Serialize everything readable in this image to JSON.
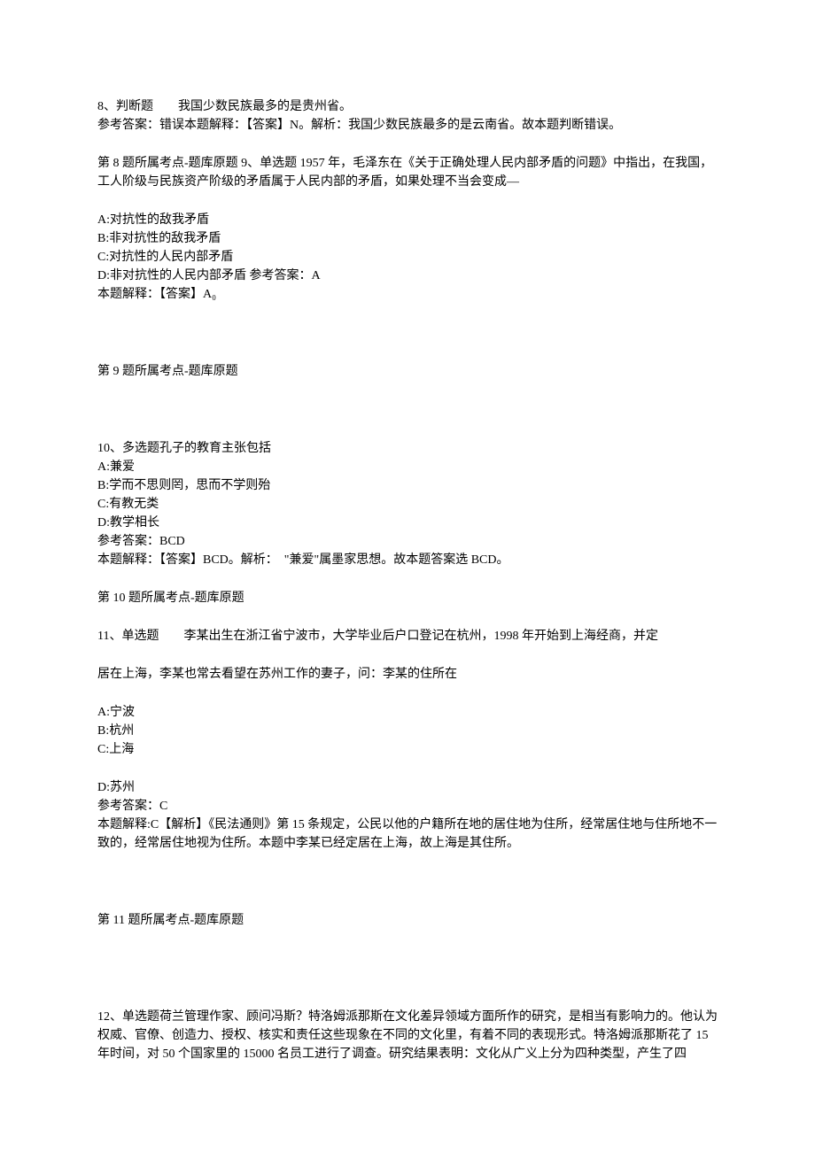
{
  "q8": {
    "line1": "8、判断题　　我国少数民族最多的是贵州省。",
    "line2": "参考答案：错误本题解释：【答案】N。解析：我国少数民族最多的是云南省。故本题判断错误。"
  },
  "q9intro": {
    "line1": "第 8 题所属考点-题库原题 9、单选题 1957 年，毛泽东在《关于正确处理人民内部矛盾的问题》中指出，在我国，工人阶级与民族资产阶级的矛盾属于人民内部的矛盾，如果处理不当会变成—"
  },
  "q9": {
    "optA": "A:对抗性的敌我矛盾",
    "optB": "B:非对抗性的敌我矛盾",
    "optC": "C:对抗性的人民内部矛盾",
    "optD": "D:非对抗性的人民内部矛盾 参考答案：A",
    "explain": "本题解释：【答案】A₀"
  },
  "q9footer": "第 9 题所属考点-题库原题",
  "q10": {
    "line1": "10、多选题孔子的教育主张包括",
    "optA": "A:兼爱",
    "optB": "B:学而不思则罔，思而不学则殆",
    "optC": "C:有教无类",
    "optD": "D:教学相长",
    "ans": "参考答案：BCD",
    "explain": "本题解释：【答案】BCD。解析：　\"兼爱\"属墨家思想。故本题答案选 BCD。"
  },
  "q10footer": "第 10 题所属考点-题库原题",
  "q11": {
    "line1": "11、单选题　　李某出生在浙江省宁波市，大学毕业后户口登记在杭州，1998 年开始到上海经商，并定",
    "line2": "居在上海，李某也常去看望在苏州工作的妻子，问：李某的住所在",
    "optA": "A:宁波",
    "optB": "B:杭州",
    "optC": "C:上海",
    "optD": "D:苏州",
    "ans": "参考答案：C",
    "explain": "本题解释:C【解析】《民法通则》第 15 条规定，公民以他的户籍所在地的居住地为住所，经常居住地与住所地不一致的，经常居住地视为住所。本题中李某已经定居在上海，故上海是其住所。"
  },
  "q11footer": "第 11 题所属考点-题库原题",
  "q12": {
    "line1": "12、单选题荷兰管理作家、顾问冯斯？特洛姆派那斯在文化差异领域方面所作的研究，是相当有影响力的。他认为权威、官僚、创造力、授权、核实和责任这些现象在不同的文化里，有着不同的表现形式。特洛姆派那斯花了 15 年时间，对 50 个国家里的 15000 名员工进行了调查。研究结果表明：文化从广义上分为四种类型，产生了四"
  }
}
